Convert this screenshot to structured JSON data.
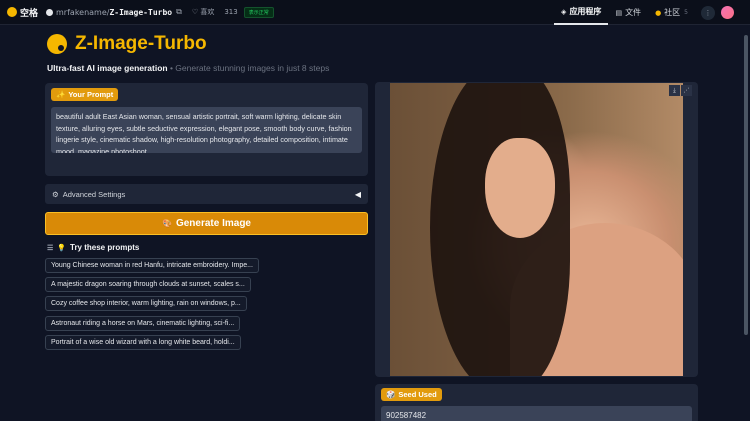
{
  "topbar": {
    "brand": "空格",
    "owner": "mrfakename/",
    "repo": "Z-Image-Turbo",
    "like_label": "♡ 喜欢",
    "like_count": "313",
    "status": "表示正常",
    "nav": [
      {
        "icon": "apps-icon",
        "label": "应用程序",
        "active": true
      },
      {
        "icon": "file-icon",
        "label": "文件",
        "active": false
      },
      {
        "icon": "community-icon",
        "label": "社区",
        "badge": "5",
        "active": false
      }
    ]
  },
  "header": {
    "title": "Z-Image-Turbo",
    "subtitle_strong": "Ultra-fast AI image generation",
    "subtitle_muted": " • Generate stunning images in just 8 steps"
  },
  "prompt": {
    "label": "Your Prompt",
    "value": "beautiful adult East Asian woman, sensual artistic portrait, soft warm lighting, delicate skin texture, alluring eyes, subtle seductive expression, elegant pose, smooth body curve, fashion lingerie style, cinematic shadow, high-resolution photography, detailed composition, intimate mood, magazine photoshoot"
  },
  "advanced": {
    "label": "Advanced Settings"
  },
  "generate": {
    "label": "Generate Image"
  },
  "examples": {
    "heading": "Try these prompts",
    "items": [
      "Young Chinese woman in red Hanfu, intricate embroidery. Impe...",
      "A majestic dragon soaring through clouds at sunset, scales s...",
      "Cozy coffee shop interior, warm lighting, rain on windows, p...",
      "Astronaut riding a horse on Mars, cinematic lighting, sci-fi...",
      "Portrait of a wise old wizard with a long white beard, holdi..."
    ]
  },
  "output": {
    "image_alt": "Generated portrait image"
  },
  "seed": {
    "label": "Seed Used",
    "value": "902587482"
  }
}
